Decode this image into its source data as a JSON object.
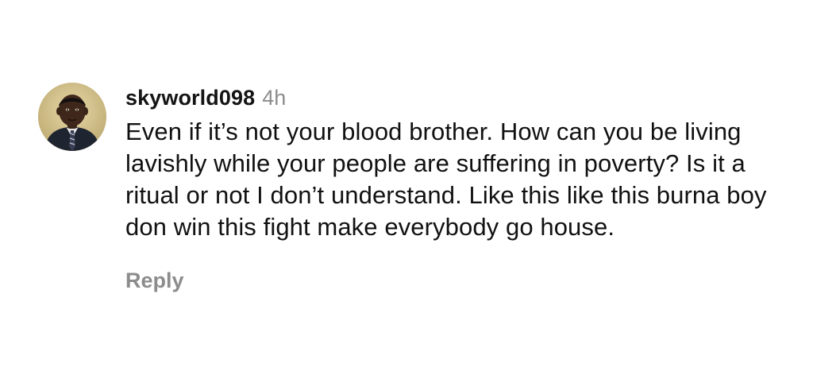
{
  "comment": {
    "avatar_icon": "user-avatar-photo",
    "username": "skyworld098",
    "timestamp": "4h",
    "text": "Even if it’s not your blood brother. How can you be living lavishly while your people are suffering in poverty? Is it a ritual or not I don’t understand. Like this like this burna boy don win this fight make everybody go house.",
    "reply_label": "Reply"
  },
  "colors": {
    "background": "#ffffff",
    "text": "#111111",
    "secondary_text": "#8c8c8c"
  }
}
